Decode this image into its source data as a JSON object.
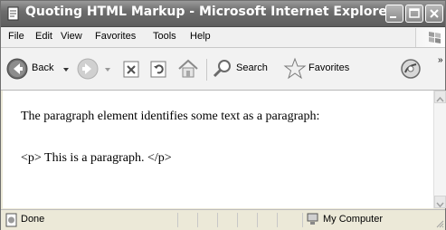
{
  "window": {
    "title": "Quoting HTML Markup - Microsoft Internet Explorer"
  },
  "menu": {
    "items": [
      "File",
      "Edit",
      "View",
      "Favorites",
      "Tools",
      "Help"
    ]
  },
  "toolbar": {
    "back_label": "Back",
    "search_label": "Search",
    "favorites_label": "Favorites",
    "overflow_label": "»"
  },
  "content": {
    "paragraph_1": "The paragraph element identifies some text as a paragraph:",
    "paragraph_2": "<p> This is a paragraph. </p>"
  },
  "status": {
    "left_text": "Done",
    "zone_text": "My Computer"
  }
}
